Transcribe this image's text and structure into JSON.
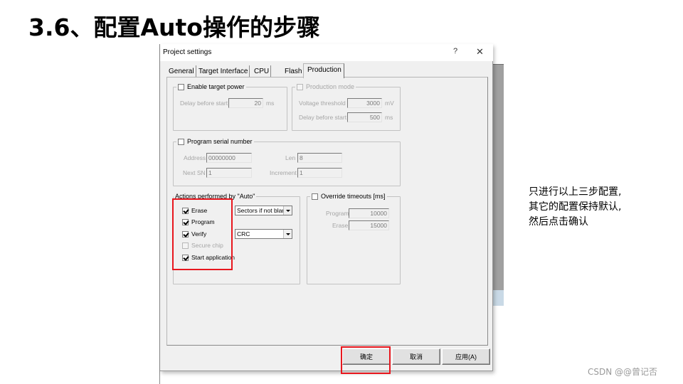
{
  "slide": {
    "title": "3.6、配置Auto操作的步骤",
    "note_lines": [
      "只进行以上三步配置,",
      "其它的配置保持默认,",
      "然后点击确认"
    ],
    "watermark": "CSDN @@曾记否",
    "highlight_color": "#e8171e"
  },
  "dialog": {
    "title": "Project settings",
    "help_icon": "?",
    "close_icon": "✕",
    "tabs": [
      {
        "label": "General",
        "active": false
      },
      {
        "label": "Target Interface",
        "active": false
      },
      {
        "label": "CPU",
        "active": false
      },
      {
        "label": "Flash",
        "active": false
      },
      {
        "label": "Production",
        "active": true
      }
    ],
    "target_power": {
      "label": "Enable target power",
      "checked": false,
      "delay_label": "Delay before start",
      "delay_value": "20",
      "delay_unit": "ms"
    },
    "production_mode": {
      "label": "Production mode",
      "checked": false,
      "enabled": false,
      "voltage_label": "Voltage threshold",
      "voltage_value": "3000",
      "voltage_unit": "mV",
      "delay_label": "Delay before start",
      "delay_value": "500",
      "delay_unit": "ms"
    },
    "serial_number": {
      "label": "Program serial number",
      "checked": false,
      "address_label": "Address",
      "address_value": "00000000",
      "len_label": "Len",
      "len_value": "8",
      "next_sn_label": "Next SN",
      "next_sn_value": "1",
      "increment_label": "Increment",
      "increment_value": "1"
    },
    "actions": {
      "label": "Actions performed by \"Auto\"",
      "items": [
        {
          "label": "Erase",
          "checked": true,
          "enabled": true
        },
        {
          "label": "Program",
          "checked": true,
          "enabled": true
        },
        {
          "label": "Verify",
          "checked": true,
          "enabled": true
        },
        {
          "label": "Secure chip",
          "checked": false,
          "enabled": false
        },
        {
          "label": "Start application",
          "checked": true,
          "enabled": true
        }
      ],
      "erase_mode": "Sectors if not blan",
      "verify_mode": "CRC"
    },
    "timeouts": {
      "label": "Override timeouts [ms]",
      "checked": false,
      "program_label": "Program",
      "program_value": "10000",
      "erase_label": "Erase",
      "erase_value": "15000"
    },
    "buttons": {
      "ok": "确定",
      "cancel": "取消",
      "apply": "应用(A)"
    }
  }
}
